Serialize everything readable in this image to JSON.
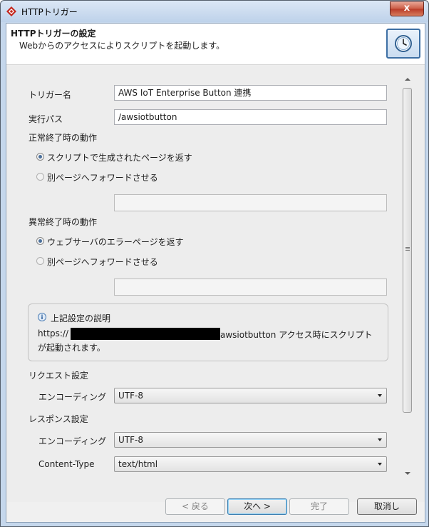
{
  "window": {
    "title": "HTTPトリガー",
    "close_label": "x"
  },
  "header": {
    "title": "HTTPトリガーの設定",
    "subtitle": "Webからのアクセスによりスクリプトを起動します。",
    "icon": "clock-icon"
  },
  "form": {
    "trigger_name": {
      "label": "トリガー名",
      "value": "AWS IoT Enterprise Button 連携"
    },
    "exec_path": {
      "label": "実行パス",
      "value": "/awsiotbutton"
    },
    "success_action": {
      "label": "正常終了時の動作",
      "options": [
        {
          "label": "スクリプトで生成されたページを返す",
          "selected": true
        },
        {
          "label": "別ページへフォワードさせる",
          "selected": false
        }
      ],
      "forward_value": ""
    },
    "error_action": {
      "label": "異常終了時の動作",
      "options": [
        {
          "label": "ウェブサーバのエラーページを返す",
          "selected": true
        },
        {
          "label": "別ページへフォワードさせる",
          "selected": false
        }
      ],
      "forward_value": ""
    },
    "info": {
      "title": "上記設定の説明",
      "line1_prefix": "https://",
      "line1_suffix": "awsiotbutton アクセス時にスクリプト",
      "line2": "が起動されます。",
      "icon": "info-icon"
    },
    "request": {
      "section_label": "リクエスト設定",
      "encoding_label": "エンコーディング",
      "encoding_value": "UTF-8"
    },
    "response": {
      "section_label": "レスポンス設定",
      "encoding_label": "エンコーディング",
      "encoding_value": "UTF-8",
      "content_type_label": "Content-Type",
      "content_type_value": "text/html"
    }
  },
  "buttons": {
    "back": "< 戻る",
    "next": "次へ >",
    "finish": "完了",
    "cancel": "取消し"
  },
  "colors": {
    "accent_blue": "#3d6fa4",
    "close_red": "#c44a34"
  }
}
